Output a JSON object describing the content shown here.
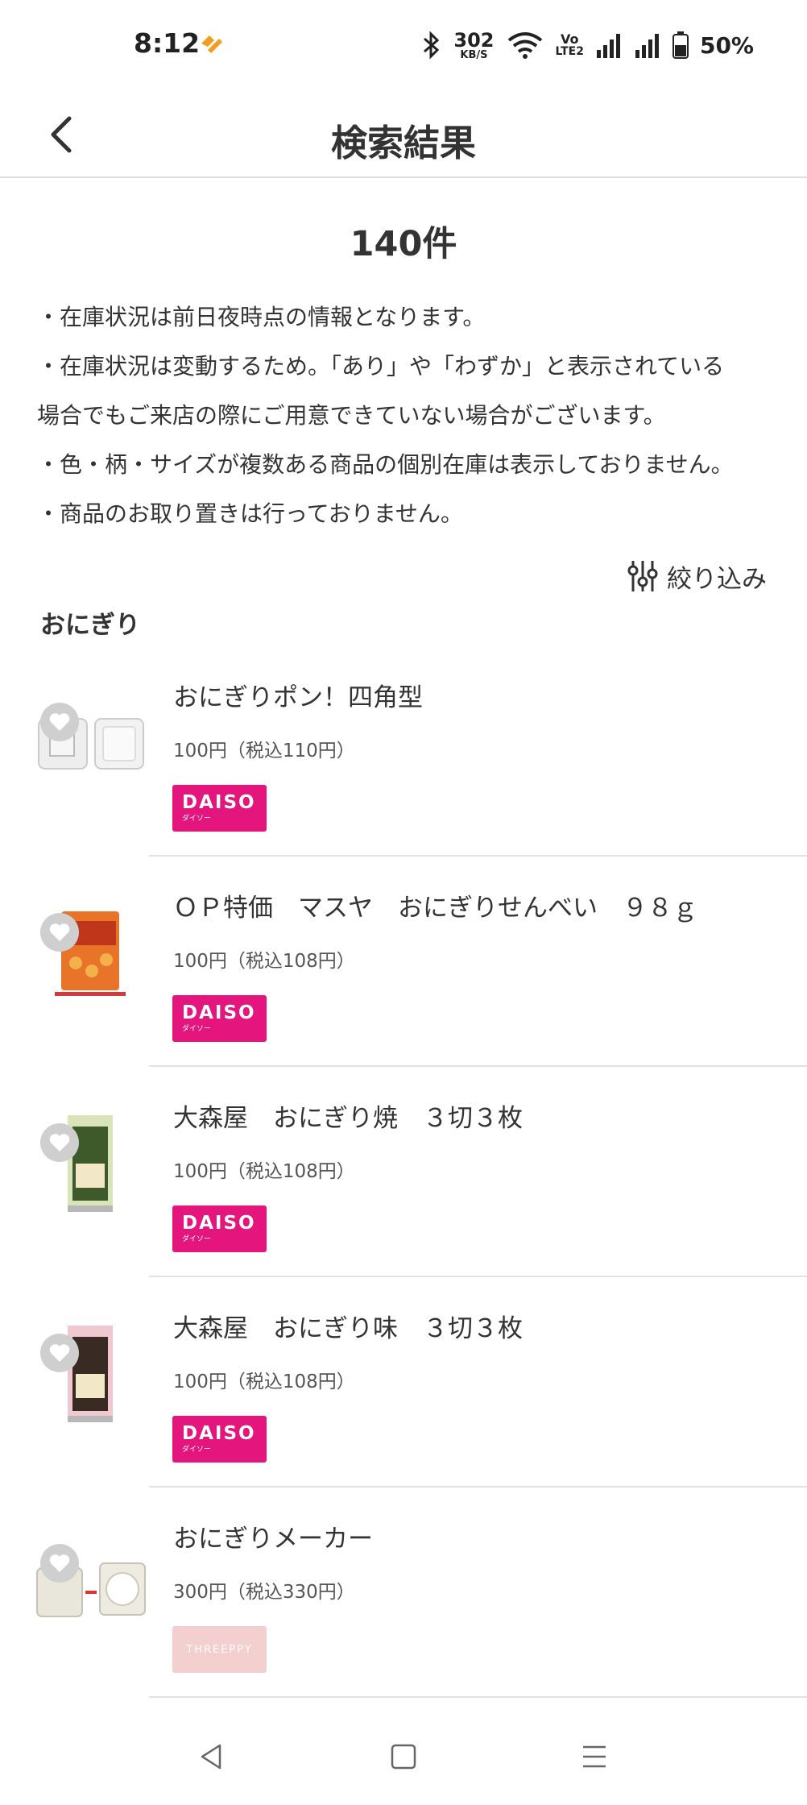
{
  "status_bar": {
    "time": "8:12",
    "net_speed_value": "302",
    "net_speed_unit": "KB/S",
    "volte_top": "Vo",
    "volte_bottom": "LTE2",
    "battery": "50%",
    "icons": [
      "bluetooth-icon",
      "wifi-icon",
      "signal-icon",
      "signal-icon-2",
      "battery-icon"
    ]
  },
  "header": {
    "title": "検索結果",
    "back_icon": "chevron-left-icon"
  },
  "summary": {
    "count": "140件",
    "notices": [
      "・在庫状況は前日夜時点の情報となります。",
      "・在庫状況は変動するため。「あり」や「わずか」と表示されている",
      "場合でもご来店の際にご用意できていない場合がございます。",
      "・色・柄・サイズが複数ある商品の個別在庫は表示しておりません。",
      "・商品のお取り置きは行っておりません。"
    ]
  },
  "filter": {
    "label": "絞り込み",
    "icon": "sliders-icon"
  },
  "category": "おにぎり",
  "products": [
    {
      "name": "おにぎりポン！四角型",
      "price": "100円（税込110円）",
      "store": "DAISO",
      "store_sub": "ダイソー",
      "thumb": "container-thumb"
    },
    {
      "name": "ＯＰ特価　マスヤ　おにぎりせんべい　９８ｇ",
      "price": "100円（税込108円）",
      "store": "DAISO",
      "store_sub": "ダイソー",
      "thumb": "snack-bag-thumb"
    },
    {
      "name": "大森屋　おにぎり焼　３切３枚",
      "price": "100円（税込108円）",
      "store": "DAISO",
      "store_sub": "ダイソー",
      "thumb": "nori-pack-thumb"
    },
    {
      "name": "大森屋　おにぎり味　３切３枚",
      "price": "100円（税込108円）",
      "store": "DAISO",
      "store_sub": "ダイソー",
      "thumb": "nori-pack-thumb"
    },
    {
      "name": "おにぎりメーカー",
      "price": "300円（税込330円）",
      "store": "THREEPPY",
      "store_sub": "",
      "thumb": "maker-thumb"
    }
  ],
  "colors": {
    "daiso": "#e4157d",
    "threeppy": "#f3cfcf",
    "divider": "#e2e2e2",
    "text": "#333333"
  },
  "bottom_nav": {
    "icons": [
      "back-triangle-icon",
      "home-square-icon",
      "menu-lines-icon"
    ]
  }
}
